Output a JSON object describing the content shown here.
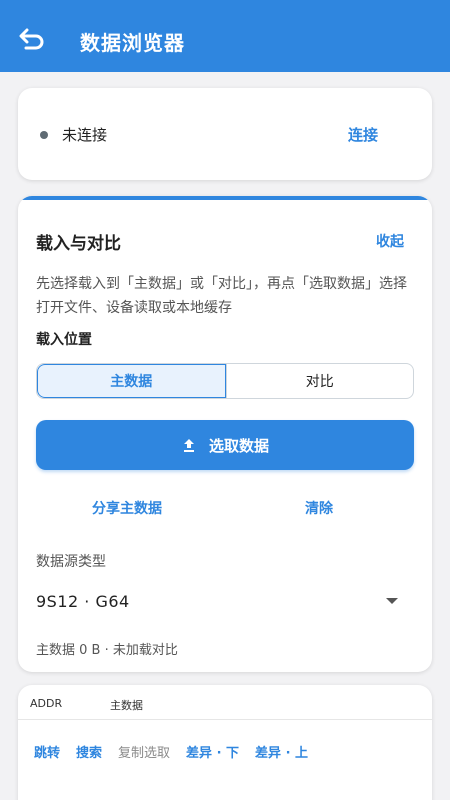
{
  "appbar": {
    "title": "数据浏览器"
  },
  "connection": {
    "status": "未连接",
    "connect_label": "连接"
  },
  "load_section": {
    "title": "载入与对比",
    "collapse_label": "收起",
    "description": "先选择载入到「主数据」或「对比」，再点「选取数据」选择打开文件、设备读取或本地缓存",
    "position_label": "载入位置",
    "segments": [
      {
        "label": "主数据",
        "selected": true
      },
      {
        "label": "对比",
        "selected": false
      }
    ],
    "select_button": "选取数据",
    "share_label": "分享主数据",
    "clear_label": "清除",
    "source_label": "数据源类型",
    "source_value": "9S12 · G64",
    "summary": "主数据 0 B · 未加载对比"
  },
  "data_view": {
    "columns": [
      "ADDR",
      "主数据"
    ],
    "tools": [
      {
        "label": "跳转",
        "enabled": true
      },
      {
        "label": "搜索",
        "enabled": true
      },
      {
        "label": "复制选取",
        "enabled": false
      },
      {
        "label": "差异 · 下",
        "enabled": true
      },
      {
        "label": "差异 · 上",
        "enabled": true
      }
    ]
  },
  "colors": {
    "primary": "#2f86df",
    "background": "#f2f2f4",
    "status_dot": "#5f6b74"
  }
}
